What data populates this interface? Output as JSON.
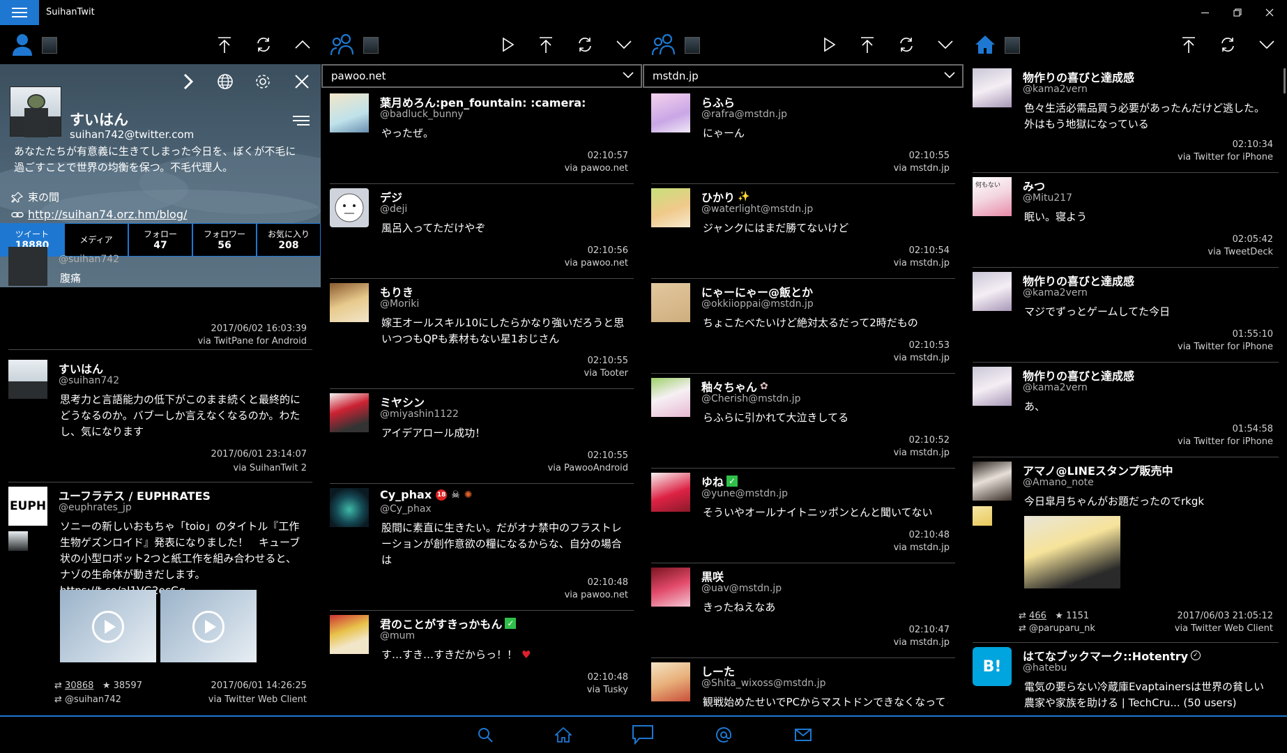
{
  "app": {
    "title": "SuihanTwit"
  },
  "profile": {
    "name": "すいはん",
    "handle": "suihan742@twitter.com",
    "bio": "あなたたちが有意義に生きてしまった今日を、ぼくが不毛に過ごすことで世界の均衡を保つ。不毛代理人。",
    "location": "束の間",
    "url": "http://suihan74.orz.hm/blog/",
    "stats": [
      {
        "label": "ツイート",
        "value": "18880"
      },
      {
        "label": "メディア",
        "value": ""
      },
      {
        "label": "フォロー",
        "value": "47"
      },
      {
        "label": "フォロワー",
        "value": "56"
      },
      {
        "label": "お気に入り",
        "value": "208"
      }
    ]
  },
  "columns": {
    "user": {
      "tweets": [
        {
          "handle": "@suihan742",
          "text": "腹痛",
          "time": "2017/06/02 16:03:39",
          "via": "via TwitPane for Android"
        },
        {
          "name": "すいはん",
          "handle": "@suihan742",
          "text": "思考力と言語能力の低下がこのまま続くと最終的にどうなるのか。バブーしか言えなくなるのか。わたし、気になります",
          "time": "2017/06/01 23:14:07",
          "via": "via SuihanTwit 2"
        },
        {
          "name": "ユーフラテス / EUPHRATES",
          "handle": "@euphrates_jp",
          "avatar_text": "EUPH",
          "text": "ソニーの新しいおもちゃ「toio」のタイトル『工作生物ゲズンロイド』発表になりました！　キューブ状の小型ロボット2つと紙工作を組み合わせると、ナゾの生命体が動きだします。https://t.co/aJ1VG2ecGq",
          "retweets": "30868",
          "favorites": "38597",
          "rt_by": "@suihan742",
          "time": "2017/06/01 14:26:25",
          "via": "via Twitter Web Client"
        }
      ]
    },
    "pawoo": {
      "instance": "pawoo.net",
      "tweets": [
        {
          "name": "葉月めろん:pen_fountain: :camera:",
          "handle": "@badluck_bunny",
          "text": "やったぜ。",
          "time": "02:10:57",
          "via": "via pawoo.net"
        },
        {
          "name": "デジ",
          "handle": "@deji",
          "text": "風呂入ってただけやぞ",
          "time": "02:10:56",
          "via": "via pawoo.net"
        },
        {
          "name": "もりき",
          "handle": "@Moriki",
          "text": "嫁王オールスキル10にしたらかなり強いだろうと思いつつもQPも素材もない星1おじさん",
          "time": "02:10:55",
          "via": "via Tooter"
        },
        {
          "name": "ミヤシン",
          "handle": "@miyashin1122",
          "text": "アイデアロール成功！",
          "time": "02:10:55",
          "via": "via PawooAndroid"
        },
        {
          "name": "Cy_phax",
          "handle": "@Cy_phax",
          "text": "股間に素直に生きたい。だがオナ禁中のフラストレーションが創作意欲の糧になるからな、自分の場合は",
          "time": "02:10:48",
          "via": "via pawoo.net"
        },
        {
          "name": "君のことがすきっかもん",
          "handle": "@mum",
          "text": "す…すき…すきだからっ！！",
          "time": "02:10:48",
          "via": "via Tusky"
        }
      ]
    },
    "mstdn": {
      "instance": "mstdn.jp",
      "tweets": [
        {
          "name": "らふら",
          "handle": "@rafra@mstdn.jp",
          "text": "にゃーん",
          "time": "02:10:55",
          "via": "via mstdn.jp"
        },
        {
          "name": "ひかり",
          "handle": "@waterlight@mstdn.jp",
          "text": "ジャンクにはまだ勝てないけど",
          "time": "02:10:54",
          "via": "via mstdn.jp"
        },
        {
          "name": "にゃーにゃー@飯とか",
          "handle": "@okkiioppai@mstdn.jp",
          "text": "ちょこたべたいけど絶対太るだって2時だもの",
          "time": "02:10:53",
          "via": "via mstdn.jp"
        },
        {
          "name": "釉々ちゃん",
          "handle": "@Cherish@mstdn.jp",
          "text": "らふらに引かれて大泣きしてる",
          "time": "02:10:52",
          "via": "via mstdn.jp"
        },
        {
          "name": "ゆね",
          "handle": "@yune@mstdn.jp",
          "text": "そういやオールナイトニッポンとんと聞いてない",
          "time": "02:10:48",
          "via": "via mstdn.jp"
        },
        {
          "name": "黒咲",
          "handle": "@uav@mstdn.jp",
          "text": "きったねえなあ",
          "time": "02:10:47",
          "via": "via mstdn.jp"
        },
        {
          "name": "しーた",
          "handle": "@Shita_wixoss@mstdn.jp",
          "text": "観戦始めたせいでPCからマストドンできなくなってし",
          "time": "",
          "via": ""
        }
      ]
    },
    "home": {
      "tweets": [
        {
          "name": "物作りの喜びと達成感",
          "handle": "@kama2vern",
          "text": "色々生活必需品買う必要があったんだけど逃した。外はもう地獄になっている",
          "time": "02:10:34",
          "via": "via Twitter for iPhone"
        },
        {
          "name": "みつ",
          "handle": "@Mitu217",
          "avatar_text": "何もない",
          "text": "眠い。寝よう",
          "time": "02:05:42",
          "via": "via TweetDeck"
        },
        {
          "name": "物作りの喜びと達成感",
          "handle": "@kama2vern",
          "text": "マジでずっとゲームしてた今日",
          "time": "01:55:10",
          "via": "via Twitter for iPhone"
        },
        {
          "name": "物作りの喜びと達成感",
          "handle": "@kama2vern",
          "text": "あ、",
          "time": "01:54:58",
          "via": "via Twitter for iPhone"
        },
        {
          "name": "アマノ@LINEスタンプ販売中",
          "handle": "@Amano_note",
          "text": "今日皐月ちゃんがお題だったのでrkgk",
          "retweets": "466",
          "favorites": "1151",
          "rt_by": "@paruparu_nk",
          "time": "2017/06/03 21:05:12",
          "via": "via Twitter Web Client"
        },
        {
          "name": "はてなブックマーク::Hotentry",
          "handle": "@hatebu",
          "avatar_text": "B!",
          "text": "電気の要らない冷蔵庫Evaptainersは世界の貧しい農家や家族を助ける | TechCru... (50 users)",
          "time": "",
          "via": ""
        }
      ]
    }
  },
  "colors": {
    "accent": "#1e78d2",
    "profile_bg": "#4f6677",
    "heart": "#e0202a",
    "check": "#2fbf4a"
  }
}
